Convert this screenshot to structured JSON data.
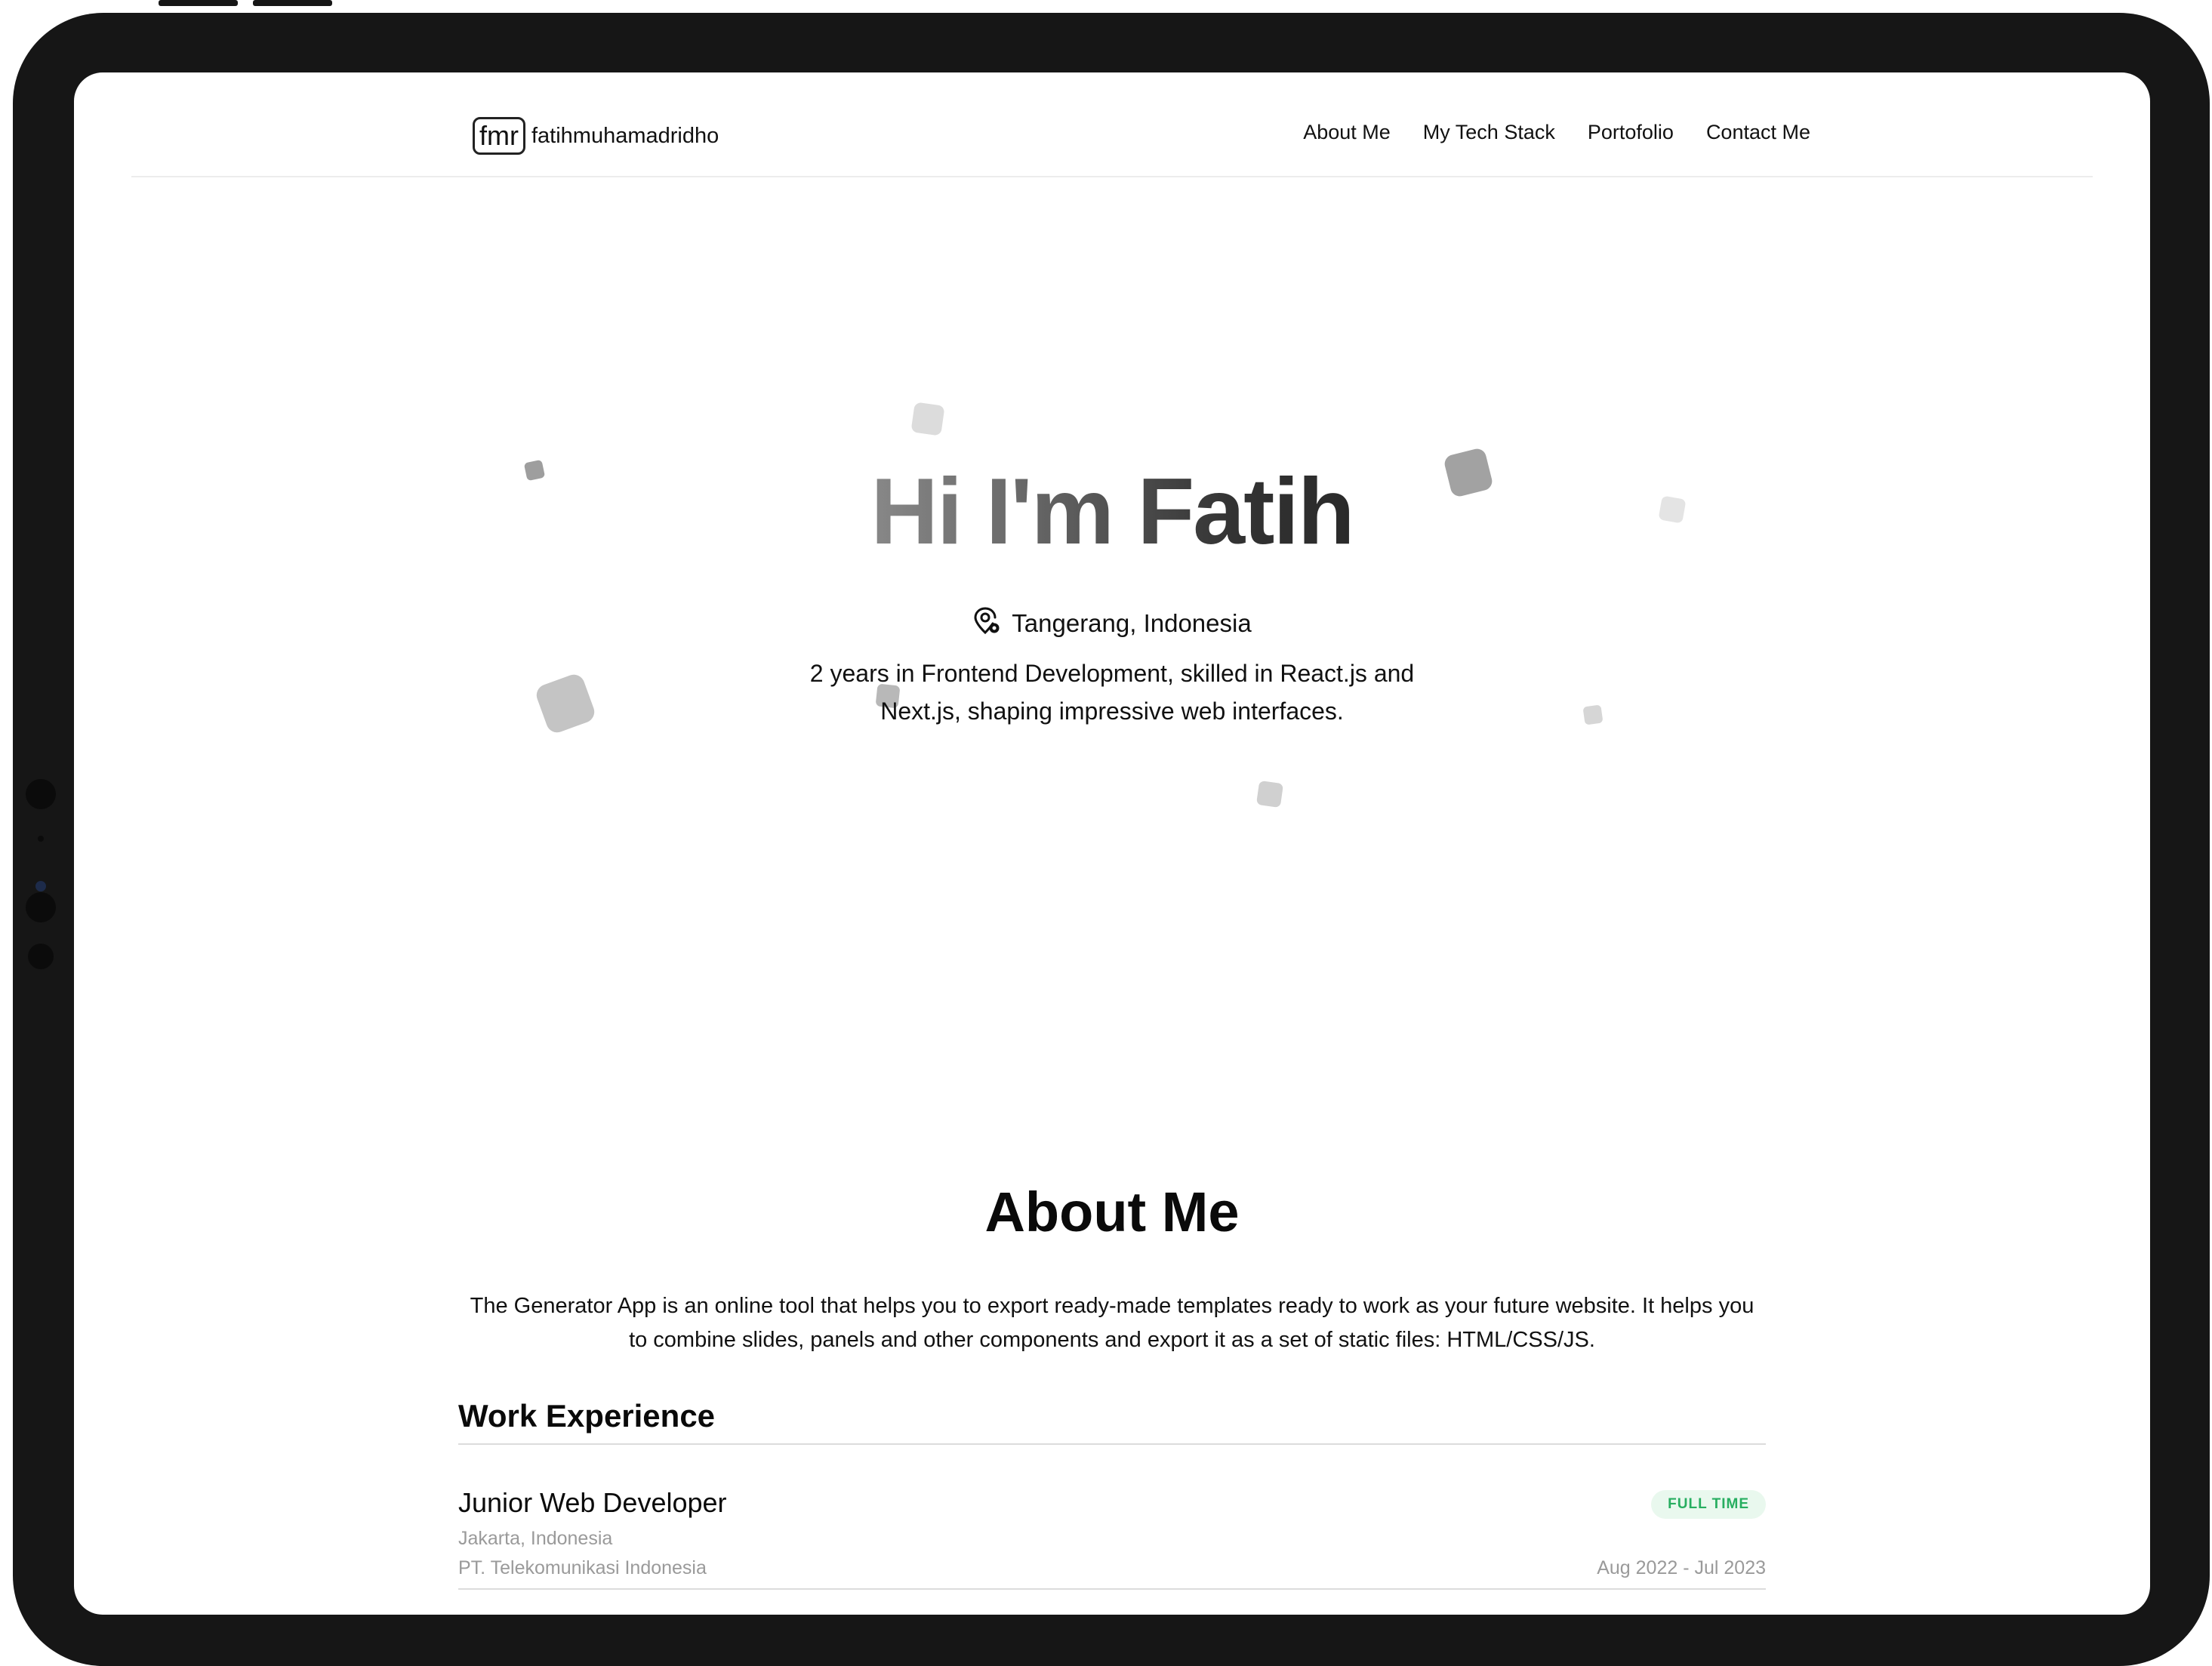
{
  "header": {
    "logo_mark": "fmr",
    "logo_name": "fatihmuhamadridho",
    "nav": [
      {
        "label": "About Me"
      },
      {
        "label": "My Tech Stack"
      },
      {
        "label": "Portofolio"
      },
      {
        "label": "Contact Me"
      }
    ]
  },
  "hero": {
    "title": "Hi I'm Fatih",
    "location": "Tangerang, Indonesia",
    "location_icon": "map-pin-icon",
    "description": "2 years in Frontend Development, skilled in React.js and Next.js, shaping impressive web interfaces."
  },
  "about": {
    "title": "About Me",
    "text": "The Generator App is an online tool that helps you to export ready-made templates ready to work as your future website. It helps you to combine slides, panels and other components and export it as a set of static files: HTML/CSS/JS.",
    "work_title": "Work Experience",
    "jobs": [
      {
        "title": "Junior Web Developer",
        "location": "Jakarta, Indonesia",
        "company": "PT. Telekomunikasi Indonesia",
        "type": "FULL TIME",
        "dates": "Aug 2022 - Jul 2023"
      }
    ]
  },
  "colors": {
    "badge_bg": "#e9f8ee",
    "badge_text": "#27ae60",
    "bezel": "#161616"
  }
}
